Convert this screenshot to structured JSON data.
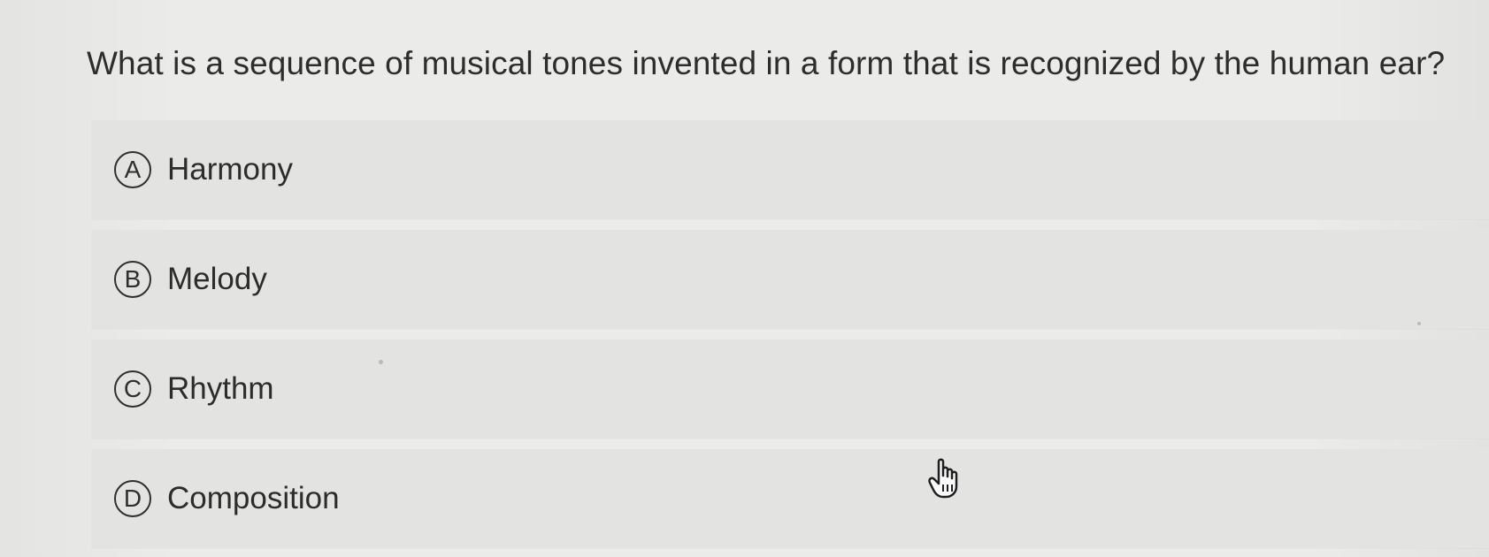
{
  "question": {
    "text": "What is a sequence of musical tones invented in a form that is recognized by the human ear?"
  },
  "options": [
    {
      "letter": "A",
      "label": "Harmony"
    },
    {
      "letter": "B",
      "label": "Melody"
    },
    {
      "letter": "C",
      "label": "Rhythm"
    },
    {
      "letter": "D",
      "label": "Composition"
    }
  ],
  "cursor": {
    "icon": "hand-pointer-icon"
  }
}
